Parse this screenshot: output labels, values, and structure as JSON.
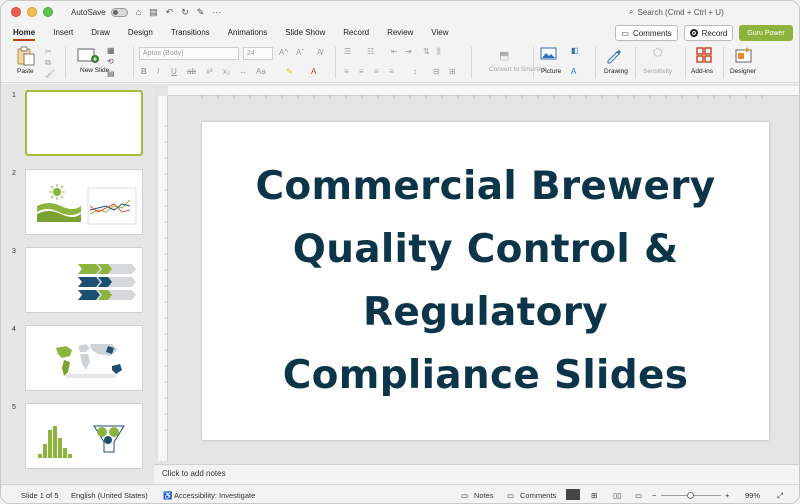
{
  "titlebar": {
    "autosave_label": "AutoSave",
    "search_placeholder": "Search (Cmd + Ctrl + U)"
  },
  "tabs": [
    {
      "label": "Home",
      "active": true
    },
    {
      "label": "Insert"
    },
    {
      "label": "Draw"
    },
    {
      "label": "Design"
    },
    {
      "label": "Transitions"
    },
    {
      "label": "Animations"
    },
    {
      "label": "Slide Show"
    },
    {
      "label": "Record"
    },
    {
      "label": "Review"
    },
    {
      "label": "View"
    }
  ],
  "actions": {
    "comments_label": "Comments",
    "record_label": "Record",
    "guru_label": "Guru Power"
  },
  "ribbon": {
    "paste_label": "Paste",
    "new_slide_label": "New Slide",
    "font_name": "Aptos (Body)",
    "font_size": "24",
    "convert_label": "Convert to SmartArt",
    "picture_label": "Picture",
    "drawing_label": "Drawing",
    "sensitivity_label": "Sensitivity",
    "addins_label": "Add-ins",
    "designer_label": "Designer"
  },
  "thumbnails": [
    {
      "num": "1"
    },
    {
      "num": "2"
    },
    {
      "num": "3"
    },
    {
      "num": "4"
    },
    {
      "num": "5"
    }
  ],
  "slide": {
    "title_lines": [
      "Commercial Brewery",
      "Quality Control &",
      "Regulatory",
      "Compliance Slides"
    ]
  },
  "notes_placeholder": "Click to add notes",
  "status": {
    "slide_count": "Slide 1 of 5",
    "language": "English (United States)",
    "accessibility": "Accessibility: Investigate",
    "notes_label": "Notes",
    "comments_label": "Comments",
    "zoom": "99%"
  },
  "colors": {
    "accent": "#c43e1c",
    "title_text": "#0c3549",
    "guru_green": "#8cb43c",
    "thumb_green": "#8cb43c",
    "thumb_blue": "#1d4f72"
  }
}
